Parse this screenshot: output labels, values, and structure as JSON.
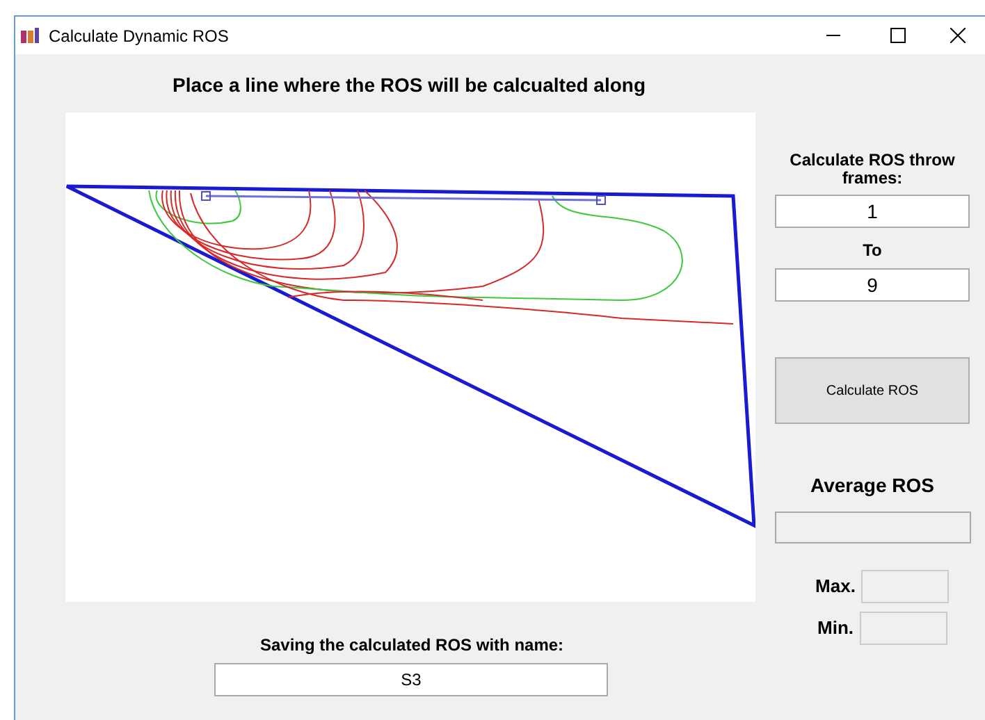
{
  "window": {
    "title": "Calculate Dynamic ROS"
  },
  "heading": "Place a line where the ROS will be calcualted along",
  "frames": {
    "label": "Calculate ROS throw frames:",
    "from": "1",
    "to_label": "To",
    "to": "9"
  },
  "calculate_button": "Calculate ROS",
  "average": {
    "label": "Average ROS"
  },
  "max_label": "Max.",
  "min_label": "Min.",
  "save": {
    "label": "Saving the calculated ROS with name:",
    "value": "S3"
  }
}
